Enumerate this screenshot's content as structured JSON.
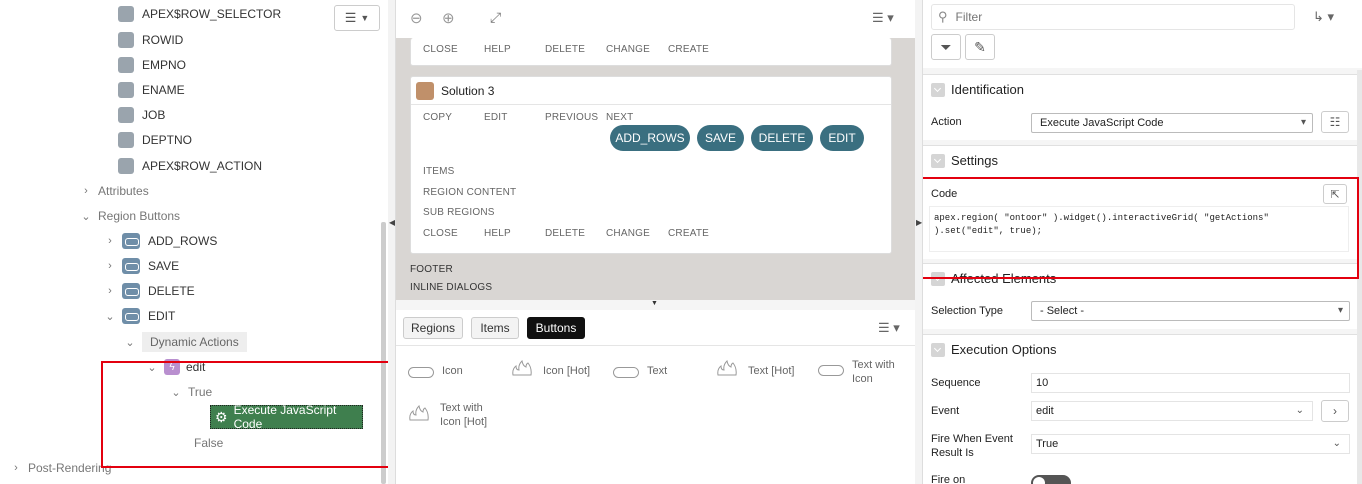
{
  "left_tree": {
    "columns": [
      "APEX$ROW_SELECTOR",
      "ROWID",
      "EMPNO",
      "ENAME",
      "JOB",
      "DEPTNO",
      "APEX$ROW_ACTION"
    ],
    "attributes": "Attributes",
    "region_buttons": "Region Buttons",
    "buttons": [
      "ADD_ROWS",
      "SAVE",
      "DELETE",
      "EDIT"
    ],
    "dynamic_actions": "Dynamic Actions",
    "da_name": "edit",
    "true_label": "True",
    "action_label": "Execute JavaScript Code",
    "false_label": "False",
    "post_rendering": "Post-Rendering"
  },
  "layout": {
    "top_positions": [
      "CLOSE",
      "HELP",
      "DELETE",
      "CHANGE",
      "CREATE"
    ],
    "region_title": "Solution 3",
    "region_positions": [
      "COPY",
      "EDIT",
      "PREVIOUS",
      "NEXT"
    ],
    "pills": [
      "ADD_ROWS",
      "SAVE",
      "DELETE",
      "EDIT"
    ],
    "body_positions": [
      "ITEMS",
      "REGION CONTENT",
      "SUB REGIONS"
    ],
    "bottom_positions": [
      "CLOSE",
      "HELP",
      "DELETE",
      "CHANGE",
      "CREATE"
    ],
    "footer": "FOOTER",
    "inline_dialogs": "INLINE DIALOGS"
  },
  "gallery": {
    "tabs": [
      "Regions",
      "Items",
      "Buttons"
    ],
    "active_tab": "Buttons",
    "items": [
      "Icon",
      "Icon [Hot]",
      "Text",
      "Text [Hot]",
      "Text with Icon",
      "Text with Icon [Hot]"
    ]
  },
  "props": {
    "filter_placeholder": "Filter",
    "identification": "Identification",
    "action_label": "Action",
    "action_value": "Execute JavaScript Code",
    "settings": "Settings",
    "code_label": "Code",
    "code_line1": "apex.region( \"ontoor\" ).widget().interactiveGrid( \"getActions\"",
    "code_line2": ").set(\"edit\", true);",
    "affected": "Affected Elements",
    "selection_type_label": "Selection Type",
    "selection_type_value": "- Select -",
    "execution": "Execution Options",
    "sequence_label": "Sequence",
    "sequence_value": "10",
    "event_label": "Event",
    "event_value": "edit",
    "fire_when_label1": "Fire When Event",
    "fire_when_label2": "Result Is",
    "fire_when_value": "True",
    "fire_on_label": "Fire on"
  },
  "colors": {
    "accent": "#3a6f80",
    "action_green": "#3f7f4e",
    "highlight": "#e3000f"
  }
}
